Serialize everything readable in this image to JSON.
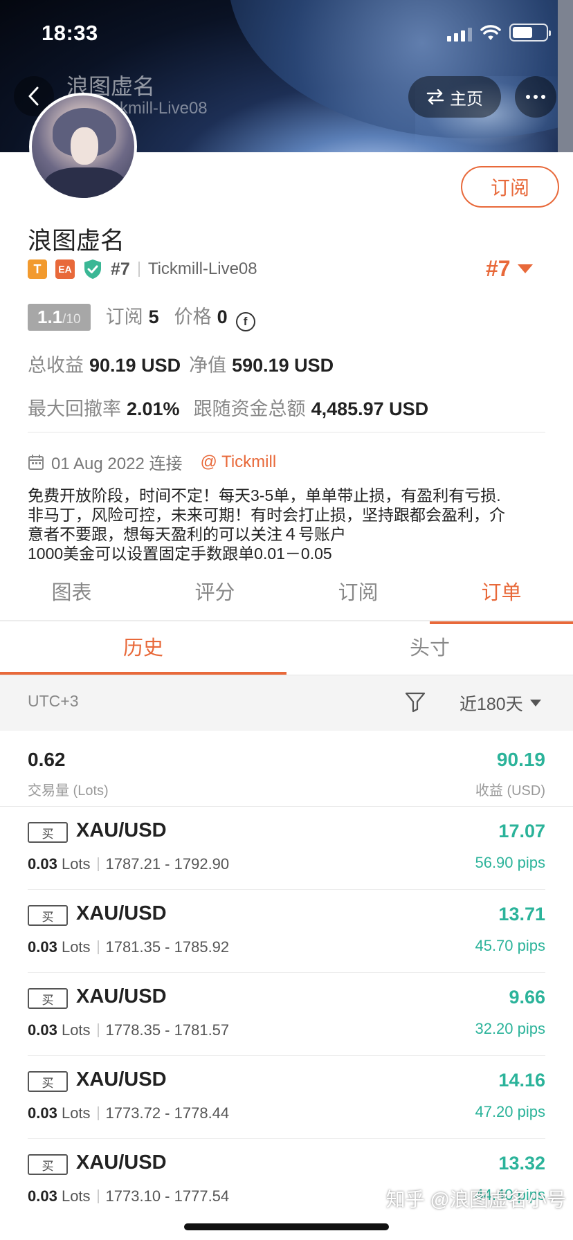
{
  "status": {
    "time": "18:33"
  },
  "header": {
    "banner_name": "浪图虚名",
    "banner_sub": "#7 | Tickmill-Live08",
    "home_label": "主页"
  },
  "profile": {
    "subscribe_label": "订阅",
    "name": "浪图虚名",
    "badge_t": "T",
    "badge_ea": "EA",
    "rank_small": "#7",
    "broker": "Tickmill-Live08",
    "rank_big": "#7",
    "score": "1.1",
    "score_max": "/10",
    "subs_label": "订阅",
    "subs_value": "5",
    "price_label": "价格",
    "price_value": "0",
    "coin_symbol": "f",
    "total_profit_label": "总收益",
    "total_profit_value": "90.19 USD",
    "equity_label": "净值",
    "equity_value": "590.19 USD",
    "drawdown_label": "最大回撤率",
    "drawdown_value": "2.01%",
    "follow_label": "跟随资金总额",
    "follow_value": "4,485.97 USD",
    "connected": "01 Aug 2022 连接",
    "at_broker": "@ Tickmill",
    "description_lines": [
      "免费开放阶段，时间不定！每天3-5单，单单带止损，有盈利有亏损.",
      "非马丁，风险可控，未来可期！有时会打止损，坚持跟都会盈利，介",
      "意者不要跟，想每天盈利的可以关注４号账户",
      "1000美金可以设置固定手数跟单0.01－0.05"
    ]
  },
  "tabs_main": [
    "图表",
    "评分",
    "订阅",
    "订单"
  ],
  "tabs_sub": [
    "历史",
    "头寸"
  ],
  "filter": {
    "timezone": "UTC+3",
    "range": "近180天"
  },
  "summary": {
    "lots": "0.62",
    "lots_label": "交易量 (Lots)",
    "profit": "90.19",
    "profit_label": "收益 (USD)"
  },
  "orders": [
    {
      "side": "买",
      "symbol": "XAU/USD",
      "lots": "0.03",
      "lots_unit": "Lots",
      "range": "1787.21 - 1792.90",
      "profit": "17.07",
      "pips": "56.90 pips"
    },
    {
      "side": "买",
      "symbol": "XAU/USD",
      "lots": "0.03",
      "lots_unit": "Lots",
      "range": "1781.35 - 1785.92",
      "profit": "13.71",
      "pips": "45.70 pips"
    },
    {
      "side": "买",
      "symbol": "XAU/USD",
      "lots": "0.03",
      "lots_unit": "Lots",
      "range": "1778.35 - 1781.57",
      "profit": "9.66",
      "pips": "32.20 pips"
    },
    {
      "side": "买",
      "symbol": "XAU/USD",
      "lots": "0.03",
      "lots_unit": "Lots",
      "range": "1773.72 - 1778.44",
      "profit": "14.16",
      "pips": "47.20 pips"
    },
    {
      "side": "买",
      "symbol": "XAU/USD",
      "lots": "0.03",
      "lots_unit": "Lots",
      "range": "1773.10 - 1777.54",
      "profit": "13.32",
      "pips": "44.40 pips"
    }
  ],
  "watermark": "知乎 @浪图虚名小号",
  "colors": {
    "accent": "#e8693a",
    "profit": "#2bb39a",
    "badge_t": "#f29a2e",
    "shield": "#3ab795"
  }
}
